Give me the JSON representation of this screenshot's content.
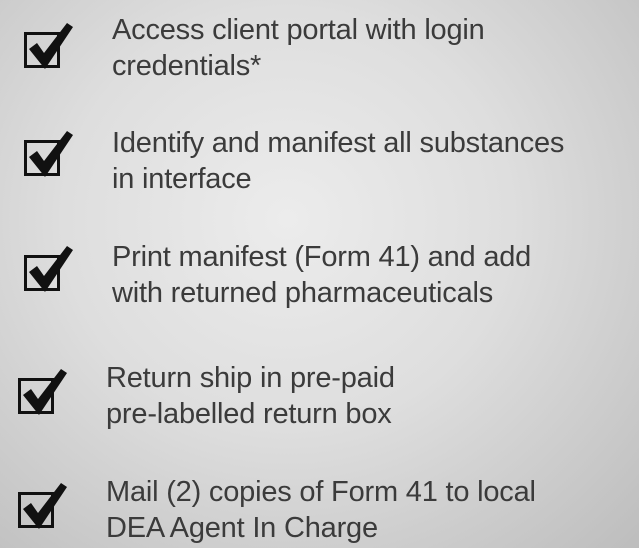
{
  "checklist": {
    "items": [
      {
        "line1": "Access client portal with login",
        "line2": "credentials*",
        "checked": true
      },
      {
        "line1": "Identify and manifest all substances",
        "line2": "in interface",
        "checked": true
      },
      {
        "line1": "Print manifest (Form 41) and add",
        "line2": "with returned pharmaceuticals",
        "checked": true
      },
      {
        "line1": "Return ship in pre-paid",
        "line2": "pre-labelled return box",
        "checked": true
      },
      {
        "line1": "Mail (2) copies of Form 41 to local",
        "line2": "DEA Agent In Charge",
        "checked": true
      }
    ]
  }
}
